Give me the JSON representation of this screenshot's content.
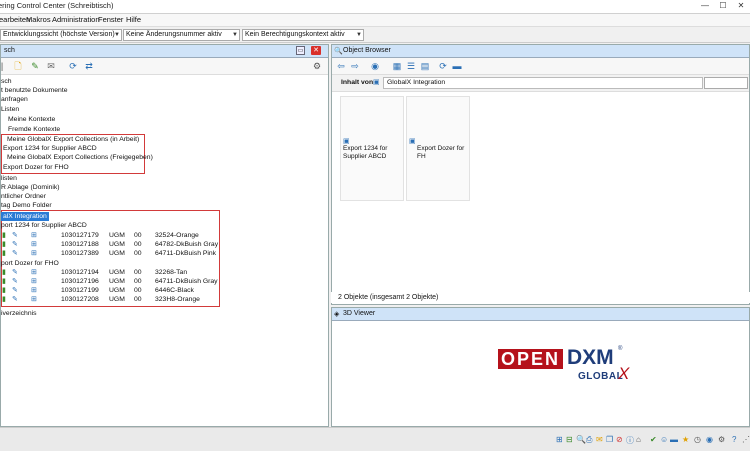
{
  "window": {
    "title": "ering Control Center (Schreibtisch)",
    "controls": [
      "—",
      "☐",
      "✕"
    ]
  },
  "menu": [
    "earbeiten",
    "Makros",
    "Administration",
    "Fenster",
    "Hilfe"
  ],
  "combos": [
    {
      "value": "Entwicklungssicht (höchste Version)"
    },
    {
      "value": "Keine Änderungsnummer aktiv"
    },
    {
      "value": "Kein Berechtigungskontext aktiv"
    }
  ],
  "left_panel": {
    "title": "sch",
    "tree": [
      {
        "text": "sch",
        "indent": 0
      },
      {
        "text": "t benutzte Dokumente",
        "indent": 0
      },
      {
        "text": "anfragen",
        "indent": 0
      },
      {
        "text": "Listen",
        "indent": 0
      },
      {
        "text": "Meine Kontexte",
        "indent": 2
      },
      {
        "text": "Fremde Kontexte",
        "indent": 2
      },
      {
        "text": "Meine GlobalX Export Collections (in Arbeit)",
        "indent": 2
      },
      {
        "text": "Export 1234 for Supplier ABCD",
        "indent": 1
      },
      {
        "text": "Meine GlobalX Export Collections (Freigegeben)",
        "indent": 2
      },
      {
        "text": "Export Dozer for FHO",
        "indent": 1
      },
      {
        "text": "listen",
        "indent": 0
      },
      {
        "text": "R Ablage (Dominik)",
        "indent": 0
      },
      {
        "text": "ntlicher Ordner",
        "indent": 0
      },
      {
        "text": "tag Demo Folder",
        "indent": 0
      },
      {
        "text": "alX Integration",
        "indent": 0,
        "selected": true
      },
      {
        "text": "port 1234 for Supplier ABCD",
        "indent": 0
      }
    ],
    "group1_rows": [
      {
        "num": "1030127179",
        "unit": "UGM",
        "ver": "00",
        "name": "32524-Orange"
      },
      {
        "num": "1030127188",
        "unit": "UGM",
        "ver": "00",
        "name": "64782-DkBuish Gray"
      },
      {
        "num": "1030127389",
        "unit": "UGM",
        "ver": "00",
        "name": "64711-DkBuish Pink"
      }
    ],
    "group2_title": "port Dozer for FHO",
    "group2_rows": [
      {
        "num": "1030127194",
        "unit": "UGM",
        "ver": "00",
        "name": "32268-Tan"
      },
      {
        "num": "1030127196",
        "unit": "UGM",
        "ver": "00",
        "name": "64711-DkBuish Gray"
      },
      {
        "num": "1030127199",
        "unit": "UGM",
        "ver": "00",
        "name": "6446C-Black"
      },
      {
        "num": "1030127208",
        "unit": "UGM",
        "ver": "00",
        "name": "323H8-Orange"
      }
    ],
    "trailing": "iverzeichnis"
  },
  "object_browser": {
    "title": "Object Browser",
    "inhalt_label": "Inhalt von",
    "path": "GlobalX Integration",
    "cards": [
      {
        "label": "Export 1234 for Supplier ABCD"
      },
      {
        "label": "Export Dozer for FH"
      }
    ],
    "status": "2 Objekte (insgesamt 2 Objekte)"
  },
  "viewer": {
    "title": "3D Viewer",
    "logo_open": "OPEN",
    "logo_dxm": "DXM",
    "logo_global": "GLOBAL",
    "logo_x": "X",
    "logo_reg": "®",
    "brand_red": "#b5121b",
    "brand_dark": "#1f3d7a"
  }
}
